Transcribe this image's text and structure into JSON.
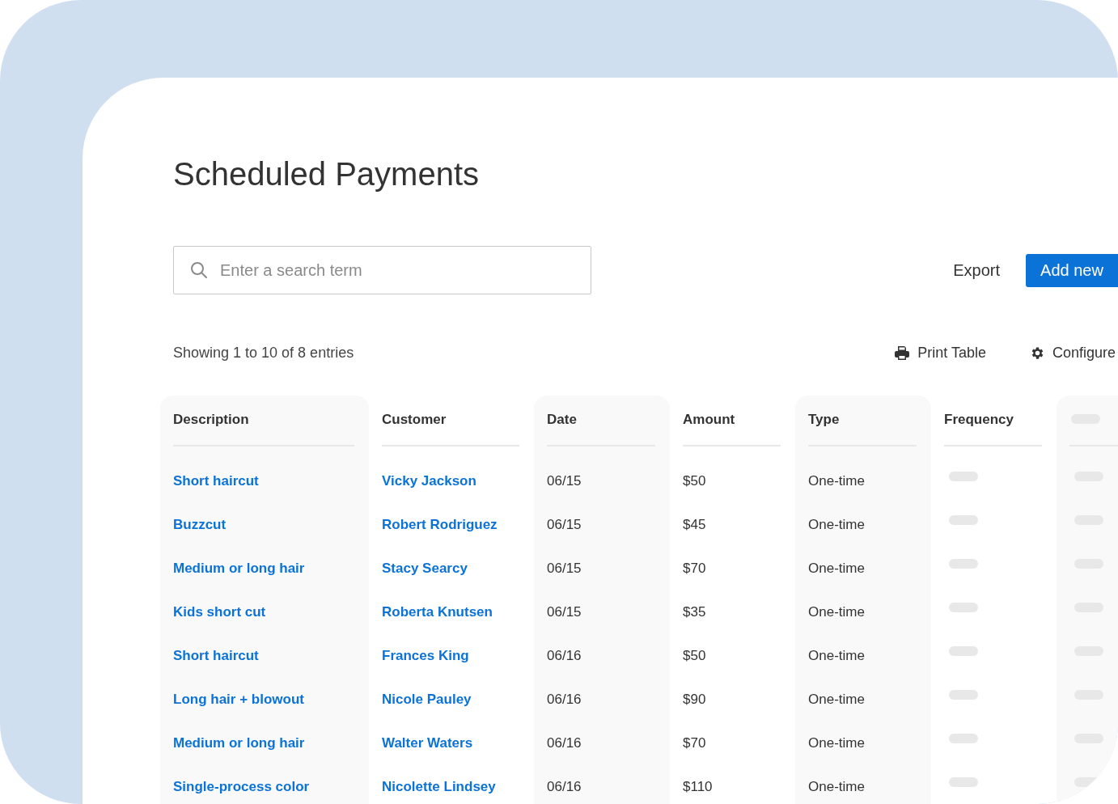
{
  "title": "Scheduled Payments",
  "search": {
    "placeholder": "Enter a search term"
  },
  "actions": {
    "export": "Export",
    "add_new": "Add new"
  },
  "summary": "Showing 1 to 10 of 8 entries",
  "tools": {
    "print": "Print Table",
    "configure": "Configure"
  },
  "table": {
    "columns": [
      "Description",
      "Customer",
      "Date",
      "Amount",
      "Type",
      "Frequency"
    ],
    "rows": [
      {
        "description": "Short haircut",
        "customer": "Vicky Jackson",
        "date": "06/15",
        "amount": "$50",
        "type": "One-time"
      },
      {
        "description": "Buzzcut",
        "customer": "Robert Rodriguez",
        "date": "06/15",
        "amount": "$45",
        "type": "One-time"
      },
      {
        "description": "Medium or long hair",
        "customer": "Stacy Searcy",
        "date": "06/15",
        "amount": "$70",
        "type": "One-time"
      },
      {
        "description": "Kids short cut",
        "customer": "Roberta Knutsen",
        "date": "06/15",
        "amount": "$35",
        "type": "One-time"
      },
      {
        "description": "Short haircut",
        "customer": "Frances King",
        "date": "06/16",
        "amount": "$50",
        "type": "One-time"
      },
      {
        "description": "Long hair + blowout",
        "customer": "Nicole Pauley",
        "date": "06/16",
        "amount": "$90",
        "type": "One-time"
      },
      {
        "description": "Medium or long hair",
        "customer": "Walter Waters",
        "date": "06/16",
        "amount": "$70",
        "type": "One-time"
      },
      {
        "description": "Single-process color",
        "customer": "Nicolette Lindsey",
        "date": "06/16",
        "amount": "$110",
        "type": "One-time"
      }
    ]
  }
}
